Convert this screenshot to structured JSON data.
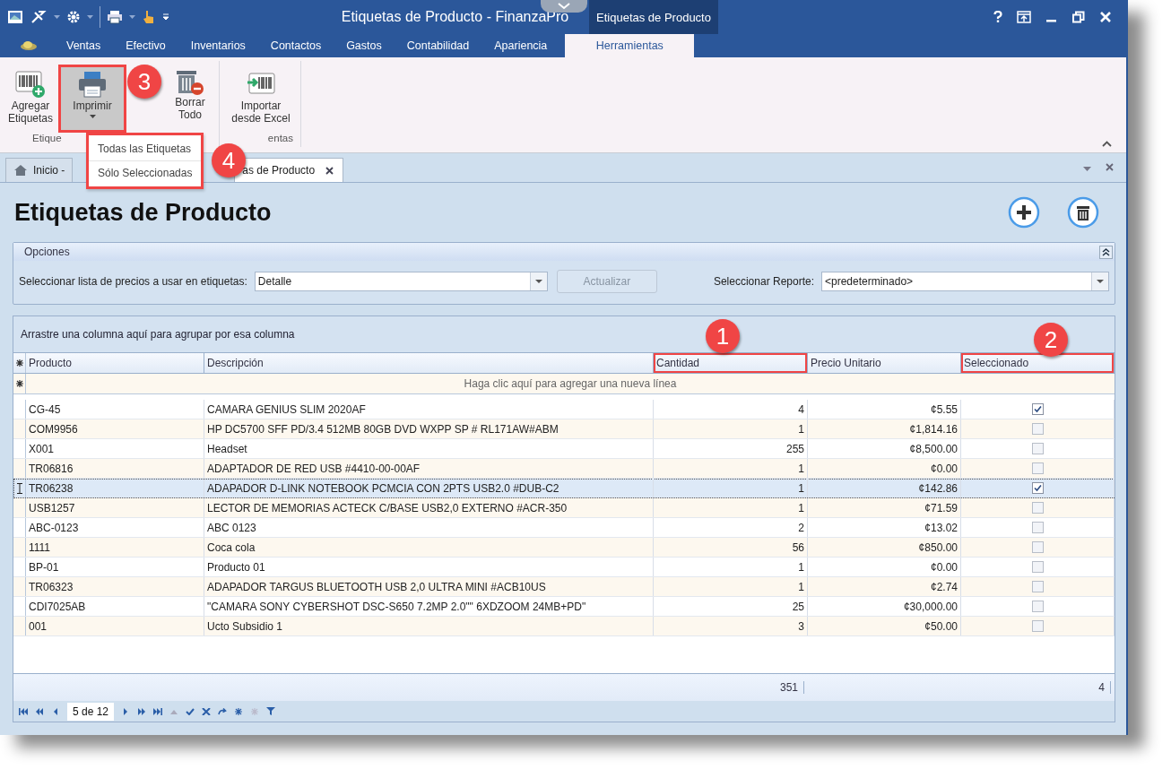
{
  "window": {
    "title": "Etiquetas de Producto - FinanzaPro",
    "context_tab": "Etiquetas de Producto"
  },
  "menu_tabs": [
    {
      "label": "Ventas",
      "selected": false
    },
    {
      "label": "Efectivo",
      "selected": false
    },
    {
      "label": "Inventarios",
      "selected": false
    },
    {
      "label": "Contactos",
      "selected": false
    },
    {
      "label": "Gastos",
      "selected": false
    },
    {
      "label": "Contabilidad",
      "selected": false
    },
    {
      "label": "Apariencia",
      "selected": false
    },
    {
      "label": "Herramientas",
      "selected": true
    }
  ],
  "ribbon": {
    "groups": [
      {
        "label": "Etique",
        "buttons": [
          {
            "kind": "add",
            "label": "Agregar Etiquetas",
            "pressed": false,
            "dropdown": false
          },
          {
            "kind": "print",
            "label": "Imprimir",
            "pressed": true,
            "dropdown": true,
            "annotation": "3"
          },
          {
            "kind": "clear",
            "label": "Borrar Todo",
            "pressed": false,
            "dropdown": false
          }
        ]
      },
      {
        "label": "entas",
        "buttons": [
          {
            "kind": "import",
            "label": "Importar desde Excel",
            "pressed": false,
            "dropdown": false
          }
        ]
      }
    ]
  },
  "dropdown_menu": {
    "annotation": "4",
    "items": [
      "Todas las Etiquetas",
      "Sólo Seleccionadas"
    ]
  },
  "doc_tabs": [
    {
      "label": "Inicio -",
      "selected": false
    },
    {
      "label": "as de Producto",
      "selected": true
    }
  ],
  "heading": "Etiquetas de Producto",
  "options": {
    "title": "Opciones",
    "price_list_label": "Seleccionar lista de precios a usar en etiquetas:",
    "price_list_value": "Detalle",
    "update_button": {
      "label": "Actualizar",
      "disabled": true
    },
    "report_label": "Seleccionar Reporte:",
    "report_value": "<predeterminado>"
  },
  "grid": {
    "group_hint": "Arrastre una columna aquí para agrupar por esa columna",
    "columns": [
      {
        "label": "Producto"
      },
      {
        "label": "Descripción"
      },
      {
        "label": "Cantidad",
        "annotation": "1"
      },
      {
        "label": "Precio Unitario"
      },
      {
        "label": "Seleccionado",
        "annotation": "2"
      }
    ],
    "new_row_hint": "Haga clic aquí para agregar una nueva línea",
    "rows": [
      {
        "product": "CG-45",
        "description": "CAMARA GENIUS SLIM 2020AF",
        "quantity": "4",
        "price": "¢5.55",
        "checked": true,
        "selected": false
      },
      {
        "product": "COM9956",
        "description": "HP DC5700 SFF PD/3.4 512MB 80GB DVD WXPP SP # RL171AW#ABM",
        "quantity": "1",
        "price": "¢1,814.16",
        "checked": false,
        "selected": false
      },
      {
        "product": "X001",
        "description": "Headset",
        "quantity": "255",
        "price": "¢8,500.00",
        "checked": false,
        "selected": false
      },
      {
        "product": "TR06816",
        "description": "ADAPTADOR DE RED USB #4410-00-00AF",
        "quantity": "1",
        "price": "¢0.00",
        "checked": false,
        "selected": false
      },
      {
        "product": "TR06238",
        "description": "ADAPADOR D-LINK NOTEBOOK PCMCIA CON 2PTS USB2.0 #DUB-C2",
        "quantity": "1",
        "price": "¢142.86",
        "checked": true,
        "selected": true
      },
      {
        "product": "USB1257",
        "description": "LECTOR DE MEMORIAS ACTECK C/BASE USB2,0 EXTERNO #ACR-350",
        "quantity": "1",
        "price": "¢71.59",
        "checked": false,
        "selected": false
      },
      {
        "product": "ABC-0123",
        "description": "ABC 0123",
        "quantity": "2",
        "price": "¢13.02",
        "checked": false,
        "selected": false
      },
      {
        "product": "1111",
        "description": "Coca cola",
        "quantity": "56",
        "price": "¢850.00",
        "checked": false,
        "selected": false
      },
      {
        "product": "BP-01",
        "description": "Producto 01",
        "quantity": "1",
        "price": "¢0.00",
        "checked": false,
        "selected": false
      },
      {
        "product": "TR06323",
        "description": "ADAPADOR TARGUS BLUETOOTH USB 2,0 ULTRA MINI #ACB10US",
        "quantity": "1",
        "price": "¢2.74",
        "checked": false,
        "selected": false
      },
      {
        "product": "CDI7025AB",
        "description": "\"CAMARA SONY CYBERSHOT DSC-S650 7.2MP 2.0\"\" 6XDZOOM 24MB+PD\"",
        "quantity": "25",
        "price": "¢30,000.00",
        "checked": false,
        "selected": false
      },
      {
        "product": "001",
        "description": "Ucto Subsidio 1",
        "quantity": "3",
        "price": "¢50.00",
        "checked": false,
        "selected": false
      }
    ],
    "totals": {
      "quantity": "351",
      "selected": "4"
    }
  },
  "navigator": {
    "position": "5 de 12"
  }
}
